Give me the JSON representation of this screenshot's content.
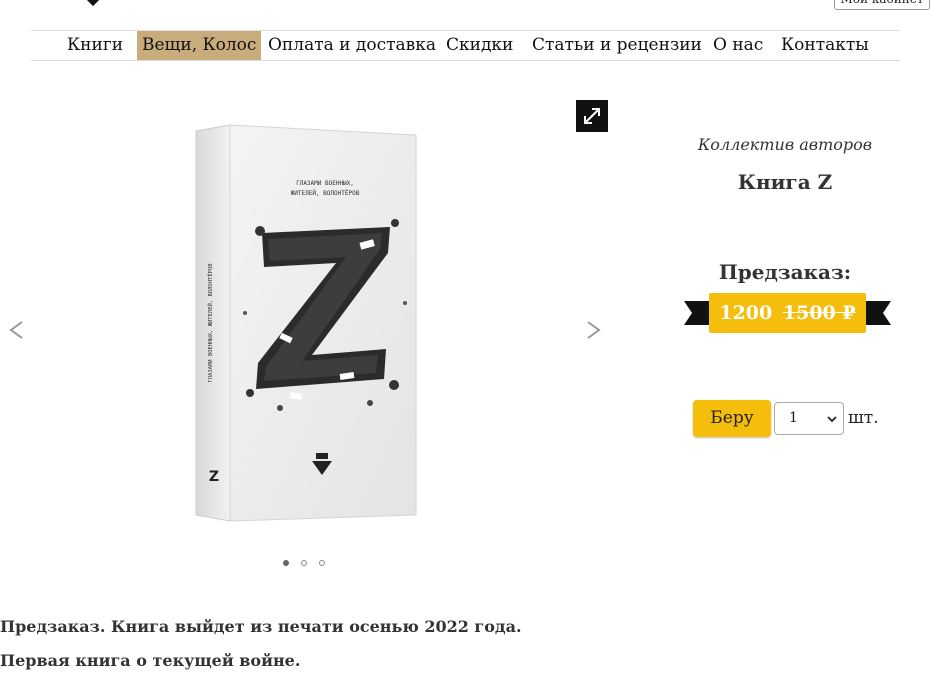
{
  "header": {
    "cabinet_label": "Мой кабинет"
  },
  "nav": {
    "items": [
      {
        "label": "Книги",
        "active": false
      },
      {
        "label": "Вещи, Колос",
        "active": true
      },
      {
        "label": "Оплата и доставка",
        "active": false
      },
      {
        "label": "Скидки",
        "active": false
      },
      {
        "label": "Статьи и рецензии",
        "active": false
      },
      {
        "label": "О нас",
        "active": false
      },
      {
        "label": "Контакты",
        "active": false
      }
    ],
    "active_color": "#c9ac7c"
  },
  "gallery": {
    "book_cover": {
      "subtitle_line1": "ГЛАЗАМИ ВОЕННЫХ,",
      "subtitle_line2": "ЖИТЕЛЕЙ, ВОЛОНТЁРОВ",
      "spine_text": "ГЛАЗАМИ ВОЕННЫХ, ЖИТЕЛЕЙ, ВОЛОНТЁРОВ",
      "big_letter": "Z",
      "spine_letter": "Z"
    },
    "slide_count": 3,
    "active_slide": 1,
    "icons": {
      "prev": "chevron-left-icon",
      "next": "chevron-right-icon",
      "expand": "expand-icon"
    }
  },
  "product": {
    "author": "Коллектив авторов",
    "title": "Книга Z",
    "preorder_label": "Предзаказ:",
    "price_current": "1200",
    "price_old": "1500",
    "currency": "₽",
    "accent_color": "#f5bd0c",
    "buy_label": "Беру",
    "quantity": "1",
    "unit_label": "шт."
  },
  "description": {
    "line1": "Предзаказ. Книга выйдет из печати осенью 2022 года.",
    "line2": "Первая книга о текущей войне."
  }
}
